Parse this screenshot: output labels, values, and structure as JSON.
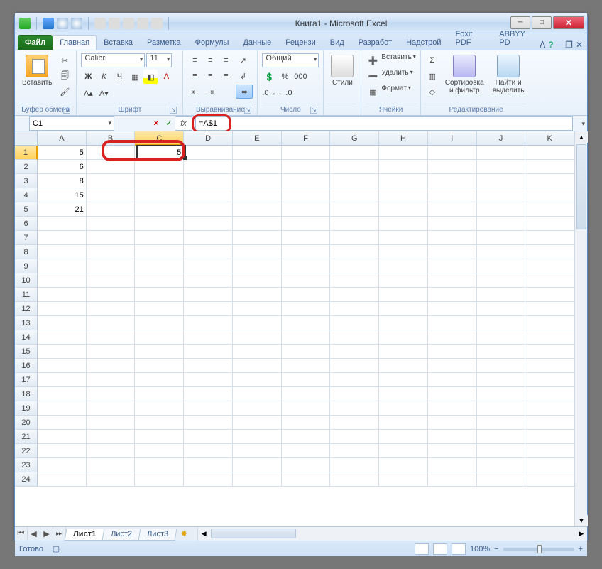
{
  "window": {
    "title": "Книга1  -  Microsoft Excel"
  },
  "tabs": {
    "file": "Файл",
    "items": [
      "Главная",
      "Вставка",
      "Разметка",
      "Формулы",
      "Данные",
      "Рецензи",
      "Вид",
      "Разработ",
      "Надстрой",
      "Foxit PDF",
      "ABBYY PD"
    ],
    "active": 0
  },
  "ribbon": {
    "clipboard": {
      "title": "Буфер обмена",
      "paste": "Вставить"
    },
    "font": {
      "title": "Шрифт",
      "name": "Calibri",
      "size": "11"
    },
    "alignment": {
      "title": "Выравнивание"
    },
    "number": {
      "title": "Число",
      "format": "Общий"
    },
    "styles": {
      "title": "",
      "btn": "Стили"
    },
    "cells": {
      "title": "Ячейки",
      "insert": "Вставить",
      "delete": "Удалить",
      "format": "Формат"
    },
    "editing": {
      "title": "Редактирование",
      "sort": "Сортировка\nи фильтр",
      "find": "Найти и\nвыделить"
    }
  },
  "formula": {
    "nameBox": "C1",
    "fx": "fx",
    "value": "=A$1"
  },
  "grid": {
    "columns": [
      "A",
      "B",
      "C",
      "D",
      "E",
      "F",
      "G",
      "H",
      "I",
      "J",
      "K"
    ],
    "rowsCount": 24,
    "selected": {
      "col": 2,
      "row": 0
    },
    "data": {
      "A1": "5",
      "A2": "6",
      "A3": "8",
      "A4": "15",
      "A5": "21",
      "C1": "5"
    }
  },
  "sheets": {
    "items": [
      "Лист1",
      "Лист2",
      "Лист3"
    ],
    "active": 0
  },
  "status": {
    "ready": "Готово",
    "zoom": "100%"
  }
}
